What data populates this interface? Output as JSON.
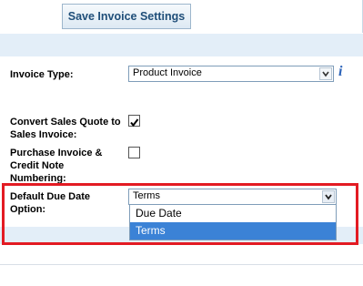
{
  "toolbar": {
    "save_label": "Save Invoice Settings"
  },
  "fields": {
    "invoice_type": {
      "label": "Invoice Type:",
      "value": "Product Invoice"
    },
    "convert_quote": {
      "label_line1": "Convert Sales Quote to",
      "label_line2": "Sales Invoice:",
      "checked": true
    },
    "purchase_numbering": {
      "label_line1": "Purchase Invoice &",
      "label_line2": "Credit Note",
      "label_line3": "Numbering:",
      "checked": false
    },
    "due_date_option": {
      "label_line1": "Default Due Date",
      "label_line2": "Option:",
      "value": "Terms",
      "options": [
        "Due Date",
        "Terms"
      ],
      "highlighted_option": "Terms"
    }
  },
  "icons": {
    "info": "i",
    "checkmark": "check-icon",
    "dropdown": "chevron-down-icon"
  },
  "colors": {
    "band": "#e3eef8",
    "highlight_border": "#e31b23",
    "selected_option": "#3b82d6",
    "button_text": "#1f4e79"
  }
}
